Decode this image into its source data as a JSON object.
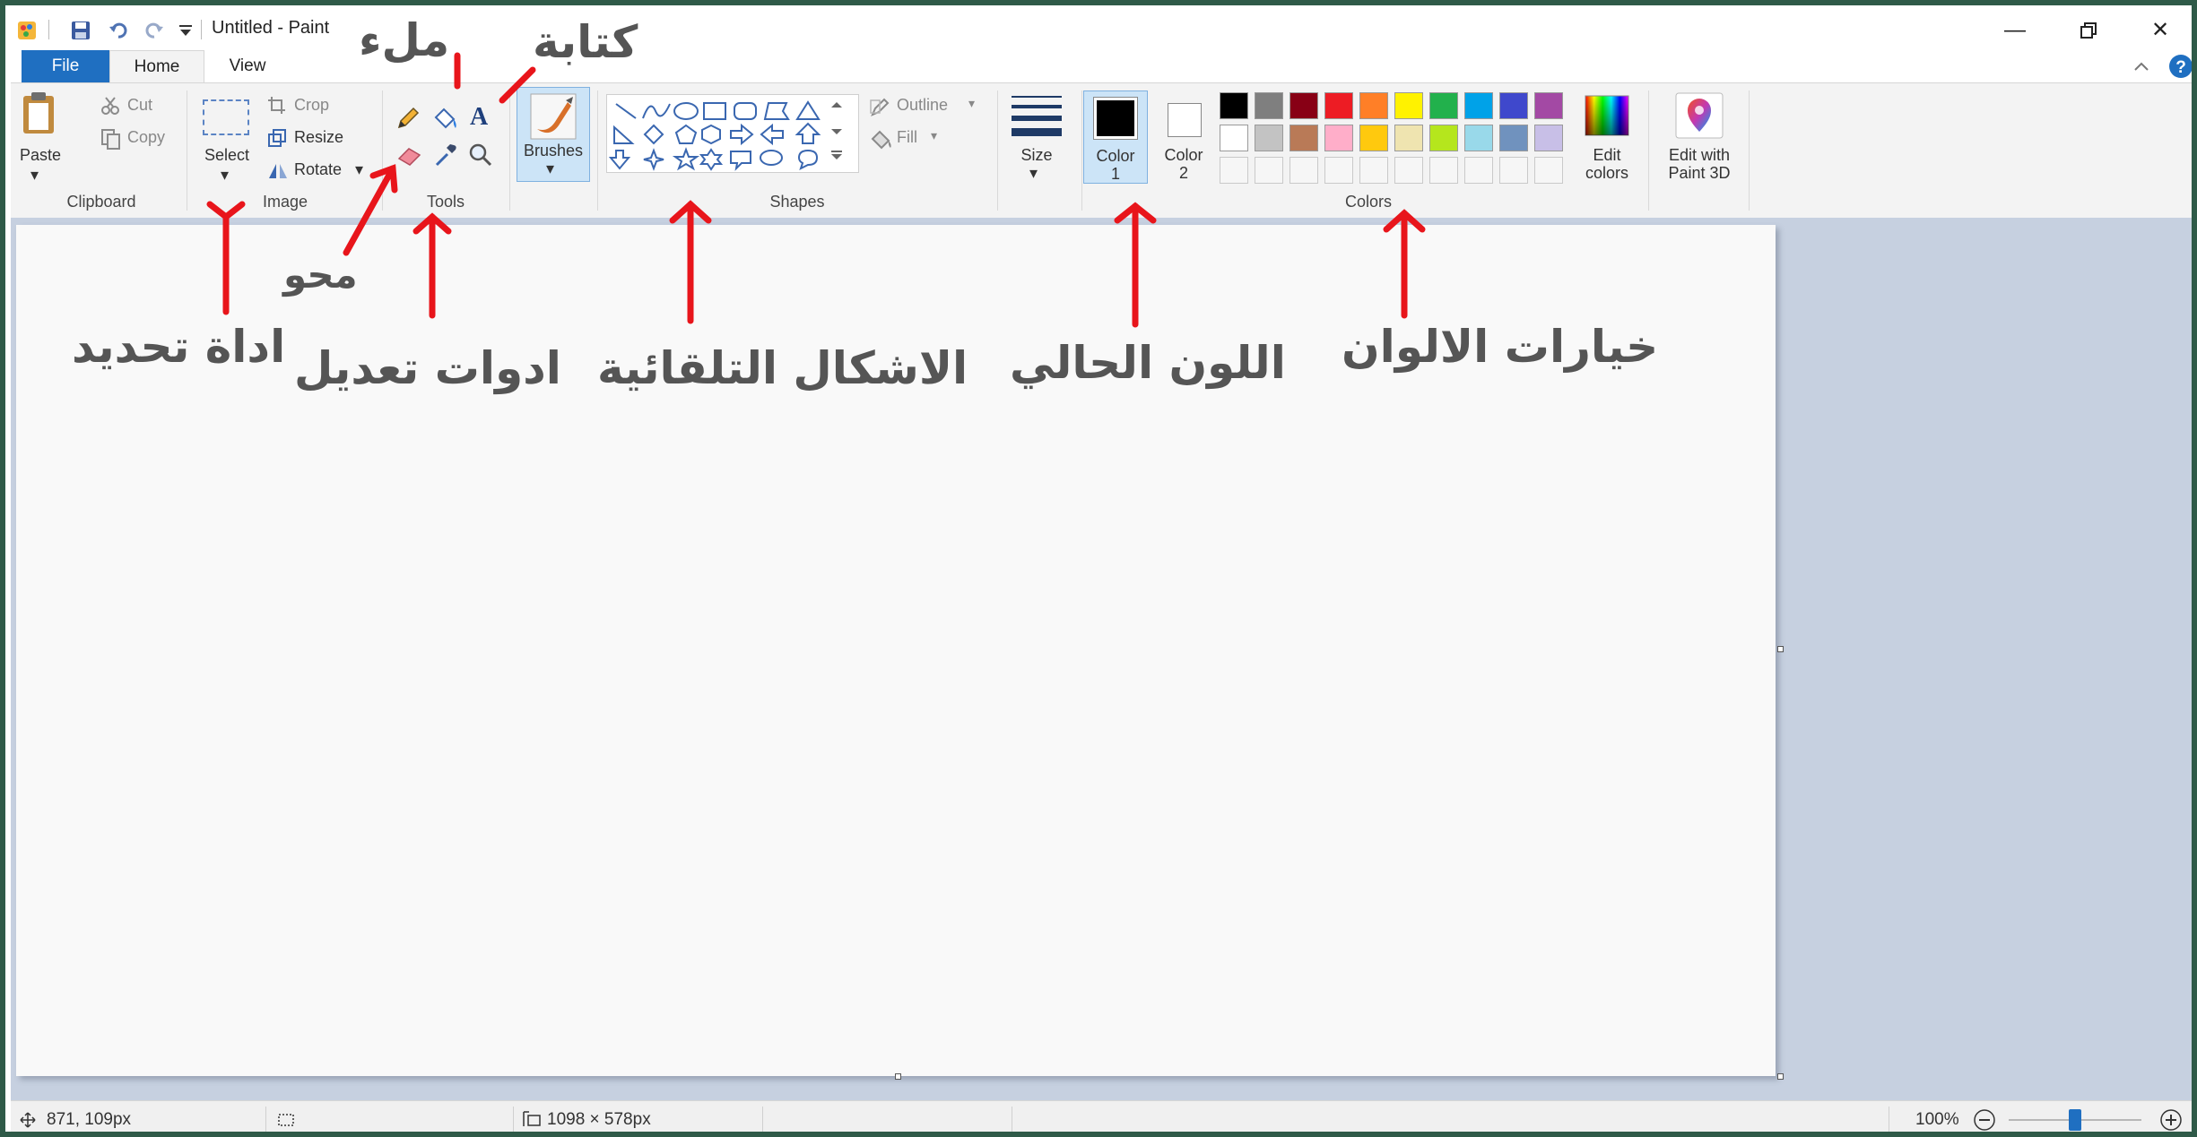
{
  "titlebar": {
    "title": "Untitled - Paint",
    "icons": [
      "paint-app-icon",
      "save-icon",
      "undo-icon",
      "redo-icon",
      "customize-quick-access-icon"
    ],
    "window_buttons": [
      "minimize-icon",
      "restore-icon",
      "close-icon"
    ]
  },
  "tabs": {
    "file": "File",
    "home": "Home",
    "view": "View"
  },
  "clipboard": {
    "paste": "Paste",
    "cut": "Cut",
    "copy": "Copy",
    "group": "Clipboard"
  },
  "image": {
    "select": "Select",
    "crop": "Crop",
    "resize": "Resize",
    "rotate": "Rotate",
    "group": "Image"
  },
  "tools": {
    "group": "Tools",
    "text_glyph": "A"
  },
  "brushes": {
    "label": "Brushes"
  },
  "shapes": {
    "outline": "Outline",
    "fill": "Fill",
    "group": "Shapes"
  },
  "size": {
    "label": "Size"
  },
  "colors": {
    "color1_line1": "Color",
    "color1_line2": "1",
    "color2_line1": "Color",
    "color2_line2": "2",
    "edit_line1": "Edit",
    "edit_line2": "colors",
    "group": "Colors",
    "color1_value": "#000000",
    "color2_value": "#ffffff",
    "palette_row1": [
      "#000000",
      "#7f7f7f",
      "#880015",
      "#ed1c24",
      "#ff7f27",
      "#fff200",
      "#22b14c",
      "#00a2e8",
      "#3f48cc",
      "#a349a4"
    ],
    "palette_row2": [
      "#ffffff",
      "#c3c3c3",
      "#b97a57",
      "#ffaec9",
      "#ffc90e",
      "#efe4b0",
      "#b5e61d",
      "#99d9ea",
      "#7092be",
      "#c8bfe7"
    ]
  },
  "paint3d": {
    "line1": "Edit with",
    "line2": "Paint 3D"
  },
  "status": {
    "cursor": "871, 109px",
    "canvas_size": "1098 × 578px",
    "zoom": "100%"
  },
  "annotations": {
    "fill": "ملء",
    "text": "كتابة",
    "erase": "محو",
    "select_tool": "اداة تحديد",
    "edit_tools": "ادوات تعديل",
    "shapes": "الاشكال التلقائية",
    "current_color": "اللون الحالي",
    "color_options": "خيارات الالوان"
  },
  "accent": {
    "file_tab": "#1f6fc1",
    "annotation_arrow": "#e8151b",
    "selected_tool": "#cce4f7"
  }
}
